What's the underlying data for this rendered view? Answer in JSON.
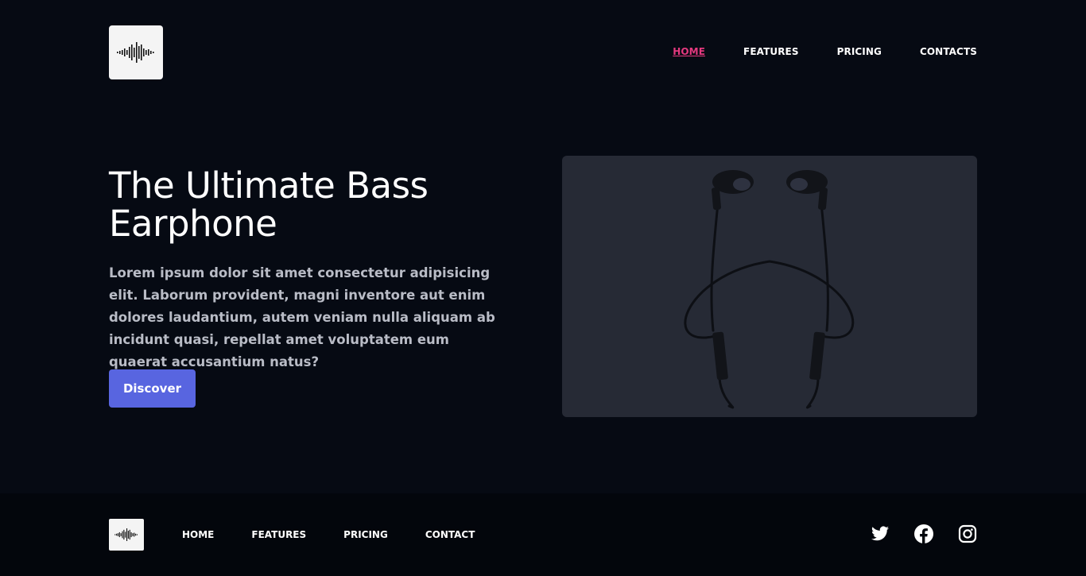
{
  "header": {
    "logo_icon": "sound-wave-icon",
    "nav": [
      {
        "label": "HOME",
        "active": true
      },
      {
        "label": "FEATURES",
        "active": false
      },
      {
        "label": "PRICING",
        "active": false
      },
      {
        "label": "CONTACTS",
        "active": false
      }
    ]
  },
  "hero": {
    "title": "The Ultimate Bass Earphone",
    "text": "Lorem ipsum dolor sit amet consectetur adipisicing elit. Laborum provident, magni inventore aut enim dolores laudantium, autem veniam nulla aliquam ab incidunt quasi, repellat amet voluptatem eum quaerat accusantium natus?",
    "button_label": "Discover",
    "image_icon": "earphones-image"
  },
  "footer": {
    "logo_icon": "sound-wave-icon",
    "nav": [
      {
        "label": "HOME"
      },
      {
        "label": "FEATURES"
      },
      {
        "label": "PRICING"
      },
      {
        "label": "CONTACT"
      }
    ],
    "social": [
      "twitter-icon",
      "facebook-icon",
      "instagram-icon"
    ]
  },
  "colors": {
    "background": "#060a13",
    "footer_background": "#03060c",
    "accent": "#e5397f",
    "button": "#5865e0",
    "image_panel": "#262a35"
  }
}
